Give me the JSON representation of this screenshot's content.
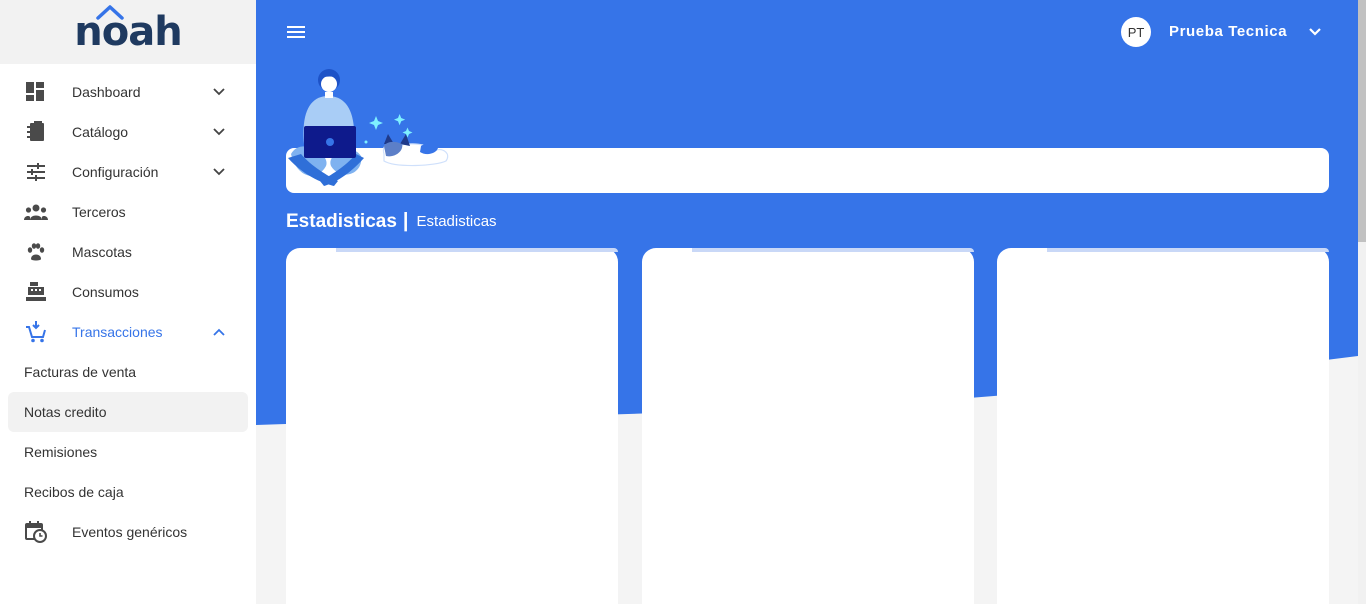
{
  "brand": {
    "logo": "noah"
  },
  "colors": {
    "primary": "#3674e8",
    "sidebar_bg": "#ffffff",
    "text": "#333333"
  },
  "sidebar": {
    "items": [
      {
        "label": "Dashboard",
        "icon": "dashboard-icon"
      },
      {
        "label": "Catálogo",
        "icon": "catalog-icon"
      },
      {
        "label": "Configuración",
        "icon": "sliders-icon"
      },
      {
        "label": "Terceros",
        "icon": "people-icon"
      },
      {
        "label": "Mascotas",
        "icon": "paw-icon"
      },
      {
        "label": "Consumos",
        "icon": "cash-register-icon"
      },
      {
        "label": "Transacciones",
        "icon": "cart-icon",
        "expanded": true
      },
      {
        "label": "Eventos genéricos",
        "icon": "calendar-clock-icon"
      }
    ],
    "subitems": [
      "Facturas de venta",
      "Notas credito",
      "Remisiones",
      "Recibos de caja"
    ],
    "selected_subitem": "Notas credito"
  },
  "topbar": {
    "menu_icon": "hamburger-icon",
    "avatar_initials": "PT",
    "user_name": "Prueba Tecnica"
  },
  "page": {
    "title": "Estadisticas",
    "separator": "|",
    "subtitle": "Estadisticas"
  }
}
